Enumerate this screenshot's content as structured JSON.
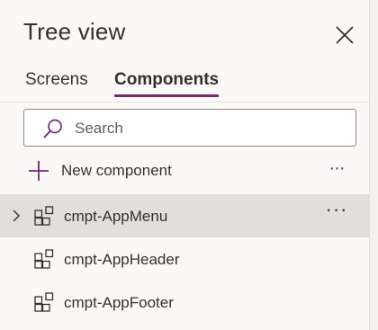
{
  "panel": {
    "title": "Tree view",
    "close_icon": "close-icon"
  },
  "tabs": [
    {
      "label": "Screens",
      "active": false
    },
    {
      "label": "Components",
      "active": true
    }
  ],
  "search": {
    "placeholder": "Search",
    "value": "",
    "icon": "search-icon"
  },
  "new_component": {
    "label": "New component",
    "icon": "plus-icon",
    "more": "···"
  },
  "components": [
    {
      "label": "cmpt-AppMenu",
      "selected": true,
      "more": "···"
    },
    {
      "label": "cmpt-AppHeader",
      "selected": false
    },
    {
      "label": "cmpt-AppFooter",
      "selected": false
    }
  ],
  "colors": {
    "accent": "#742774",
    "panel_background": "#faf9f8",
    "selected_row": "#e1dfdd"
  }
}
